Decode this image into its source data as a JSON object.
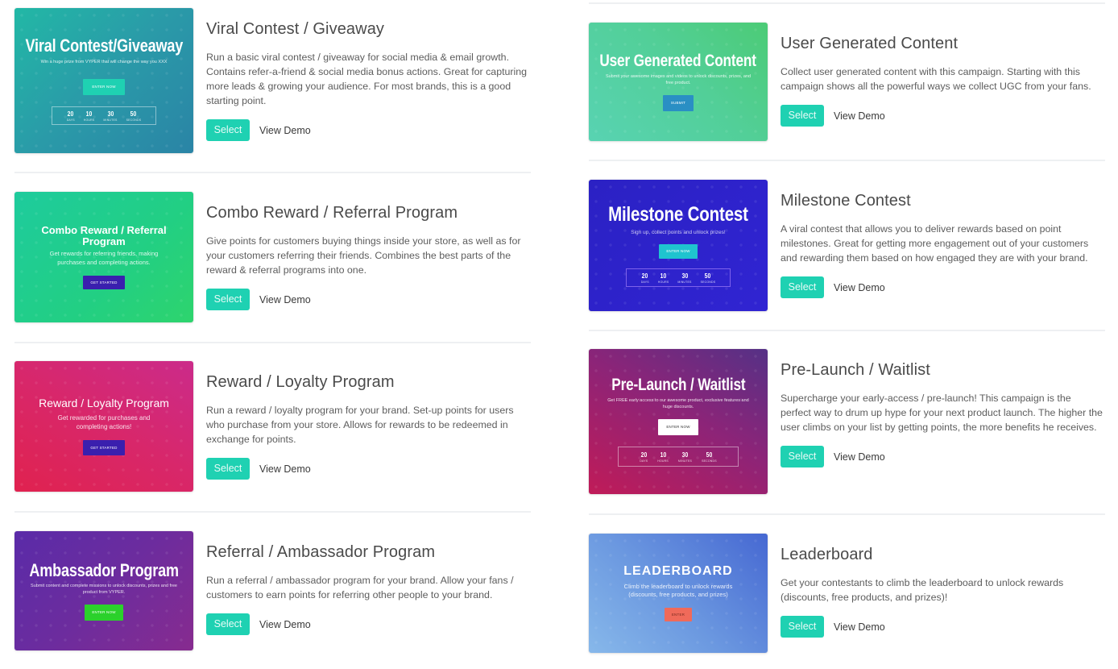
{
  "common": {
    "select_label": "Select",
    "demo_label": "View Demo",
    "accent": "#1fd1b2"
  },
  "countdown": {
    "days": "20",
    "hours": "10",
    "minutes": "30",
    "seconds": "50",
    "days_label": "DAYS",
    "hours_label": "HOURS",
    "minutes_label": "MINUTES",
    "seconds_label": "SECONDS"
  },
  "campaigns": {
    "viral": {
      "title": "Viral Contest / Giveaway",
      "description": "Run a basic viral contest / giveaway for social media & email growth. Contains refer-a-friend & social media bonus actions. Great for capturing more leads & growing your audience. For most brands, this is a good starting point.",
      "thumb_title": "Viral Contest/Giveaway",
      "thumb_subtitle": "Win a huge prize from VYPER that will change the way you XXX",
      "thumb_button": "ENTER NOW",
      "colors": [
        "#23b6a8",
        "#2a8fa6"
      ]
    },
    "combo": {
      "title": "Combo Reward / Referral Program",
      "description": "Give points for customers buying things inside your store, as well as for your customers referring their friends. Combines the best parts of the reward & referral programs into one.",
      "thumb_title": "Combo Reward / Referral Program",
      "thumb_subtitle": "Get rewards for referring friends, making purchases and completing actions.",
      "thumb_button": "GET STARTED",
      "colors": [
        "#1fcd9a",
        "#2dd36f"
      ]
    },
    "loyalty": {
      "title": "Reward / Loyalty Program",
      "description": "Run a reward / loyalty program for your brand. Set-up points for users who purchase from your store. Allows for rewards to be redeemed in exchange for points.",
      "thumb_title": "Reward / Loyalty Program",
      "thumb_subtitle": "Get rewarded for purchases and completing actions!",
      "thumb_button": "GET STARTED",
      "colors": [
        "#e0225a",
        "#cf2a86"
      ]
    },
    "ambassador": {
      "title": "Referral / Ambassador Program",
      "description": "Run a referral / ambassador program for your brand. Allow your fans / customers to earn points for referring other people to your brand.",
      "thumb_title": "Ambassador Program",
      "thumb_subtitle": "Submit content and complete missions to unlock discounts, prizes and free product from VYPER.",
      "thumb_button": "ENTER NOW",
      "colors": [
        "#5b2aa6",
        "#8a2a8e"
      ]
    },
    "ugc": {
      "title": "User Generated Content",
      "description": "Collect user generated content with this campaign. Starting with this campaign shows all the powerful ways we collect UGC from your fans.",
      "thumb_title": "User Generated Content",
      "thumb_subtitle": "Submit your awesome images and videos to unlock discounts, prizes, and free product.",
      "thumb_button": "SUBMIT",
      "colors": [
        "#55d1ad",
        "#4fcb7c"
      ]
    },
    "milestone": {
      "title": "Milestone Contest",
      "description": "A viral contest that allows you to deliver rewards based on point milestones. Great for getting more engagement out of your customers and rewarding them based on how engaged they are with your brand.",
      "thumb_title": "Milestone Contest",
      "thumb_subtitle": "Sign up, collect points and unlock prizes!",
      "thumb_button": "ENTER NOW",
      "colors": [
        "#2a22c9",
        "#3324d4"
      ]
    },
    "prelaunch": {
      "title": "Pre-Launch / Waitlist",
      "description": "Supercharge your early-access / pre-launch! This campaign is the perfect way to drum up hype for your next product launch. The higher the user climbs on your list by getting points, the more benefits he receives.",
      "thumb_title": "Pre-Launch / Waitlist",
      "thumb_subtitle": "Get FREE early access to our awesome product, exclusive features and huge discounts.",
      "thumb_button": "ENTER NOW",
      "colors": [
        "#b81c5c",
        "#5a2f8a"
      ]
    },
    "leaderboard": {
      "title": "Leaderboard",
      "description": "Get your contestants to climb the leaderboard to unlock rewards (discounts, free products, and prizes)!",
      "thumb_title": "LEADERBOARD",
      "thumb_subtitle": "Climb the leaderboard to unlock rewards (discounts, free products, and prizes)",
      "thumb_button": "ENTER",
      "colors": [
        "#7eb0e8",
        "#4667d4"
      ]
    }
  }
}
